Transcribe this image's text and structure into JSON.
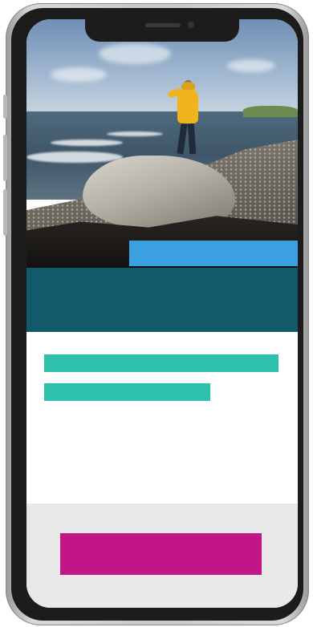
{
  "colors": {
    "background": "#ffffff",
    "accent_bar": "#3aa0e0",
    "banner": "#125a6a",
    "text_placeholder": "#2ec1ae",
    "cta_button": "#c21686"
  },
  "hero": {
    "image_icon": "coastal-photo-person-yellow-jacket"
  }
}
